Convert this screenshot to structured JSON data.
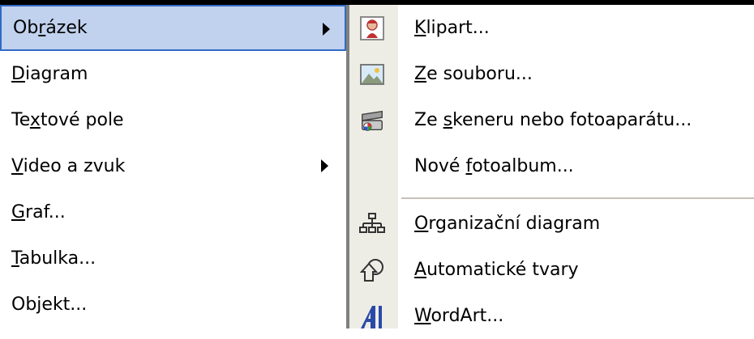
{
  "menu": {
    "items": [
      {
        "pre": "Ob",
        "key": "r",
        "post": "ázek",
        "has_submenu": true,
        "highlighted": true
      },
      {
        "pre": "",
        "key": "D",
        "post": "iagram",
        "has_submenu": false
      },
      {
        "pre": "Te",
        "key": "x",
        "post": "tové pole",
        "has_submenu": false
      },
      {
        "pre": "",
        "key": "V",
        "post": "ideo a zvuk",
        "has_submenu": true
      },
      {
        "pre": "",
        "key": "G",
        "post": "raf...",
        "has_submenu": false
      },
      {
        "pre": "",
        "key": "T",
        "post": "abulka...",
        "has_submenu": false
      },
      {
        "pre": "Ob",
        "key": "j",
        "post": "ekt...",
        "has_submenu": false
      }
    ]
  },
  "submenu": {
    "items": [
      {
        "pre": "",
        "key": "K",
        "post": "lipart...",
        "icon": "clipart-icon"
      },
      {
        "pre": "",
        "key": "Z",
        "post": "e souboru...",
        "icon": "picture-file-icon"
      },
      {
        "pre": "Ze ",
        "key": "s",
        "post": "keneru nebo fotoaparátu...",
        "icon": "scanner-icon"
      },
      {
        "pre": "Nové ",
        "key": "f",
        "post": "otoalbum...",
        "icon": ""
      },
      {
        "pre": "",
        "key": "O",
        "post": "rganizační diagram",
        "icon": "org-chart-icon"
      },
      {
        "pre": "",
        "key": "A",
        "post": "utomatické tvary",
        "icon": "autoshapes-icon"
      },
      {
        "pre": "",
        "key": "W",
        "post": "ordArt...",
        "icon": "wordart-icon"
      }
    ]
  },
  "colors": {
    "highlight_bg": "#c1d2ee",
    "highlight_border": "#316ac5",
    "gutter": "#eeede5"
  }
}
